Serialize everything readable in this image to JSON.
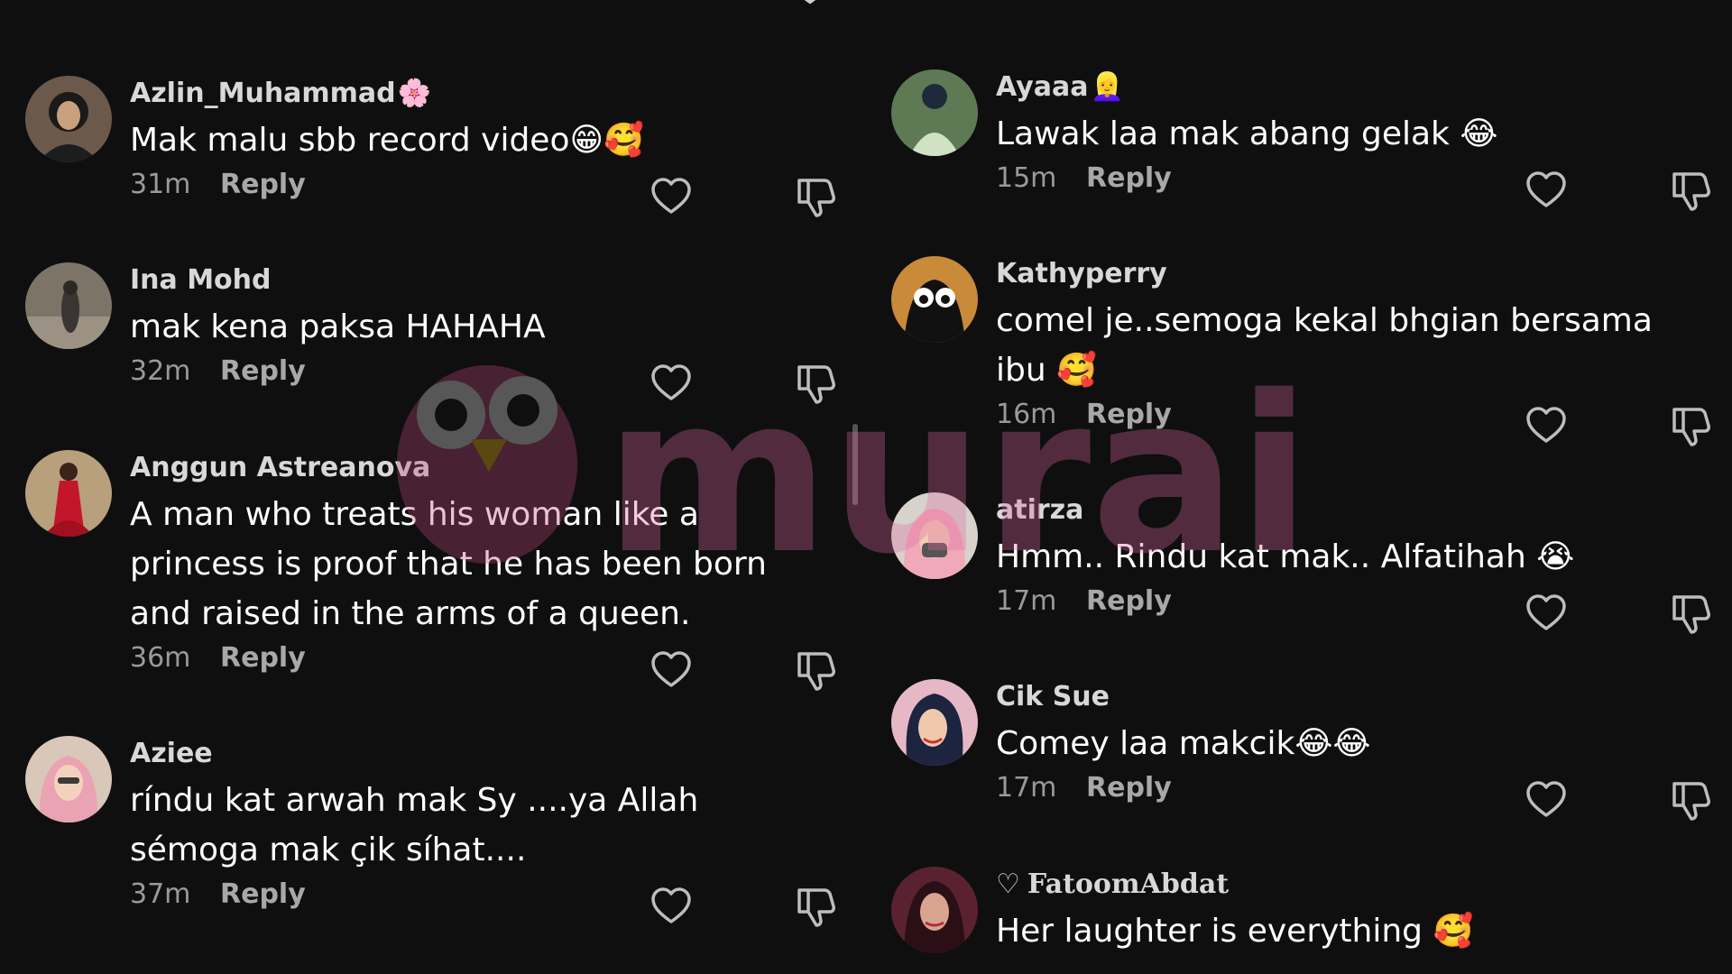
{
  "comments_left": [
    {
      "username": "Azlin_Muhammad",
      "username_emoji": "🌸",
      "text": "Mak malu sbb record video😁🥰",
      "time": "31m",
      "reply": "Reply"
    },
    {
      "username": "Ina Mohd",
      "text": "mak kena paksa HAHAHA",
      "time": "32m",
      "reply": "Reply"
    },
    {
      "username": "Anggun Astreanova",
      "text": "A man who treats his woman like a princess is proof that he has been born and raised in the arms of a queen.",
      "time": "36m",
      "reply": "Reply"
    },
    {
      "username": "Aziee",
      "text": "ríndu kat arwah mak Sy ....ya Allah sémoga mak çik síhat....",
      "time": "37m",
      "reply": "Reply"
    }
  ],
  "comments_right": [
    {
      "username": "Ayaaa",
      "username_emoji": "👱‍♀️",
      "text": "Lawak laa mak abang gelak 😂",
      "time": "15m",
      "reply": "Reply"
    },
    {
      "username": "Kathyperry",
      "text": "comel je..semoga kekal bhgian bersama ibu 🥰",
      "time": "16m",
      "reply": "Reply"
    },
    {
      "username": "atirza",
      "text": "Hmm.. Rindu kat mak.. Alfatihah 😭",
      "time": "17m",
      "reply": "Reply"
    },
    {
      "username": "Cik Sue",
      "text": "Comey laa makcik😂😂",
      "time": "17m",
      "reply": "Reply"
    },
    {
      "username": "FatoomAbdat",
      "username_prefix": "♡",
      "text": "Her laughter is everything 🥰"
    }
  ],
  "watermark": {
    "brand": "murai"
  },
  "icons": {
    "like": "heart-outline-icon",
    "dislike": "thumbs-down-outline-icon",
    "close": "close-icon"
  },
  "colors": {
    "background": "#0f0f10",
    "text": "#ffffff",
    "secondary": "#9a9a9a"
  }
}
